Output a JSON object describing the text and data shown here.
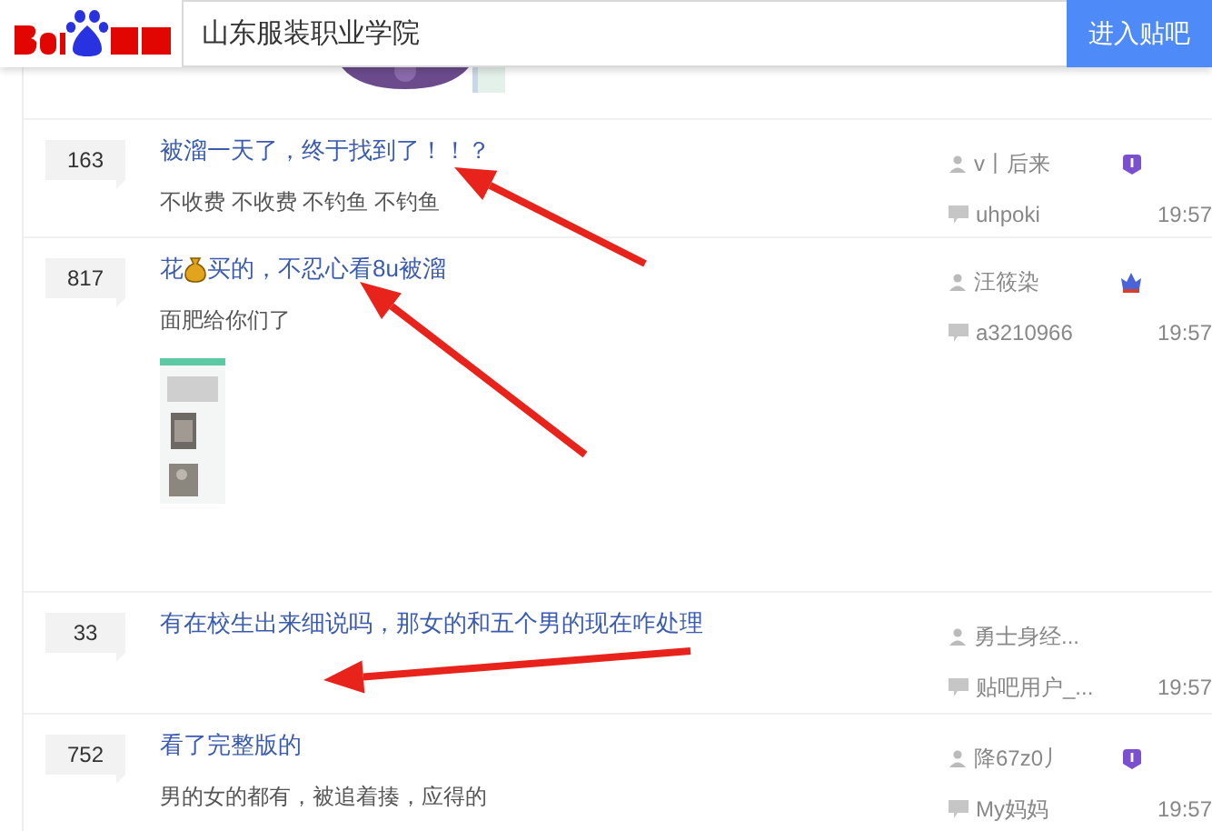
{
  "header": {
    "search": {
      "value": "山东服装职业学院"
    },
    "button": "进入贴吧"
  },
  "threads": [
    {
      "replies": "163",
      "title": [
        {
          "text": "被溜一天了，终于找到了！！？"
        }
      ],
      "excerpt": "不收费 不收费 不钓鱼 不钓鱼",
      "author": "v丨后来",
      "badge": {
        "kind": "level"
      },
      "last_reply": "uhpoki",
      "time": "19:57"
    },
    {
      "replies": "817",
      "title": [
        {
          "text": "花"
        },
        {
          "kind": "money-bag"
        },
        {
          "text": "买的，不忍心看8u被溜"
        }
      ],
      "excerpt": "面肥给你们了",
      "media": {
        "kind": "picture"
      },
      "author": "汪筱染",
      "badge": {
        "kind": "crown"
      },
      "last_reply": "a3210966",
      "time": "19:57"
    },
    {
      "replies": "33",
      "title": [
        {
          "text": "有在校生出来细说吗，那女的和五个男的现在咋处理"
        }
      ],
      "author": "勇士身经...",
      "last_reply": "贴吧用户_...",
      "time": "19:57"
    },
    {
      "replies": "752",
      "title": [
        {
          "text": "看了完整版的"
        }
      ],
      "excerpt": "男的女的都有，被追着揍，应得的",
      "author": "降67z0丿",
      "badge": {
        "kind": "level"
      },
      "last_reply": "My妈妈",
      "time": "19:57"
    }
  ]
}
